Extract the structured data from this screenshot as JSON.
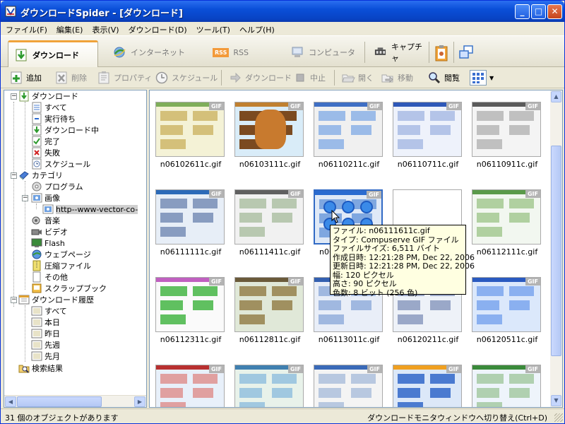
{
  "window": {
    "title": "ダウンロードSpider - [ダウンロード]",
    "minimize": "_",
    "maximize": "□",
    "close": "✕"
  },
  "menu": [
    "ファイル(F)",
    "編集(E)",
    "表示(V)",
    "ダウンロード(D)",
    "ツール(T)",
    "ヘルプ(H)"
  ],
  "tabs": {
    "download": "ダウンロード",
    "internet": "インターネット",
    "rss_badge": "RSS",
    "rss": "RSS",
    "computer": "コンピュータ",
    "capture": "キャプチャ"
  },
  "toolbar": {
    "add": "追加",
    "delete": "削除",
    "properties": "プロパティ",
    "schedule": "スケジュール",
    "download": "ダウンロード",
    "stop": "中止",
    "open": "開く",
    "move": "移動",
    "browse": "閲覧"
  },
  "tree": {
    "download": "ダウンロード",
    "all": "すべて",
    "waiting": "実行待ち",
    "downloading": "ダウンロード中",
    "complete": "完了",
    "failed": "失敗",
    "schedule": "スケジュール",
    "category": "カテゴリ",
    "program": "プログラム",
    "image": "画像",
    "image_sub": "http--www-vector-co-",
    "music": "音楽",
    "video": "ビデオ",
    "flash": "Flash",
    "webpage": "ウェブページ",
    "archive": "圧縮ファイル",
    "other": "その他",
    "scrapbook": "スクラップブック",
    "history": "ダウンロード履歴",
    "h_all": "すべて",
    "h_today": "本日",
    "h_yesterday": "昨日",
    "h_lastweek": "先週",
    "h_lastmonth": "先月",
    "search": "検索結果"
  },
  "files": {
    "badge": "GIF",
    "items": [
      "n06102611c.gif",
      "n06103111c.gif",
      "n06110211c.gif",
      "n06110711c.gif",
      "n06110911c.gif",
      "n06111111c.gif",
      "n06111411c.gif",
      "n06111611c.gif",
      "",
      "n06112111c.gif",
      "n06112311c.gif",
      "n06112811c.gif",
      "n06113011c.gif",
      "n06120211c.gif",
      "n06120511c.gif",
      "",
      "",
      "",
      "",
      ""
    ],
    "visible_label_8": "n06"
  },
  "tooltip": {
    "file": "ファイル: n06111611c.gif",
    "type": "タイプ: Compuserve GIF ファイル",
    "size": "ファイルサイズ: 6,511 バイト",
    "created": "作成日時: 12:21:28 PM, Dec 22, 2006",
    "modified": "更新日時: 12:21:28 PM, Dec 22, 2006",
    "width": "幅: 120 ピクセル",
    "height": "高さ: 90 ピクセル",
    "color": "色数: 8 ビット (256 色)"
  },
  "status": {
    "left": "31 個のオブジェクトがあります",
    "right": "ダウンロードモニタウィンドウへ切り替え(Ctrl+D)"
  }
}
